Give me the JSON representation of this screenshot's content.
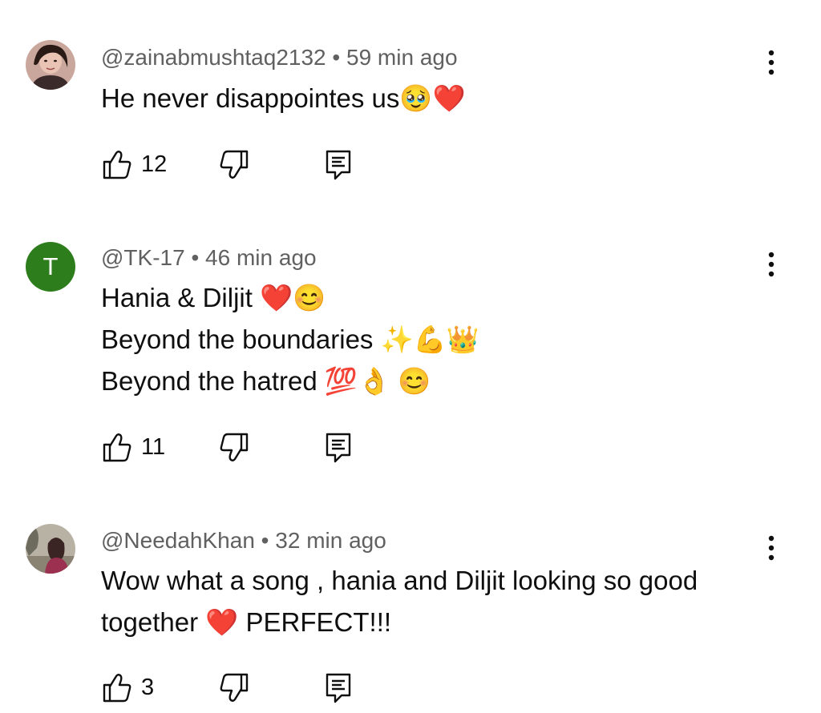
{
  "comments": [
    {
      "author": "@zainabmushtaq2132",
      "time": "59 min ago",
      "lines": [
        "He never disappointes us🥹❤️"
      ],
      "likes": "12"
    },
    {
      "author": "@TK-17",
      "avatar_letter": "T",
      "avatar_color": "#2e7d1c",
      "time": "46 min ago",
      "lines": [
        "Hania & Diljit ❤️😊",
        "Beyond the boundaries ✨💪👑",
        "Beyond the hatred 💯👌 😊"
      ],
      "likes": "11"
    },
    {
      "author": "@NeedahKhan",
      "time": "32 min ago",
      "lines": [
        "Wow what a song , hania and Diljit looking so good",
        "together ❤️ PERFECT!!!"
      ],
      "likes": "3"
    }
  ],
  "separator": " • ",
  "icons": {
    "like": "thumb-up-icon",
    "dislike": "thumb-down-icon",
    "reply": "reply-icon",
    "more": "more-vert-icon"
  }
}
